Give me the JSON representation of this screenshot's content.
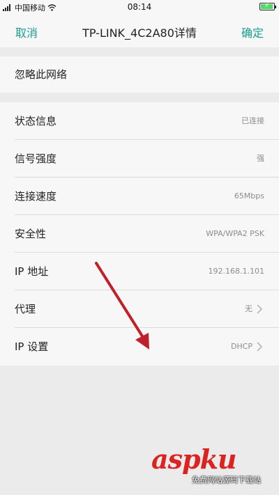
{
  "status_bar": {
    "carrier": "中国移动",
    "time": "08:14"
  },
  "nav": {
    "cancel": "取消",
    "title": "TP-LINK_4C2A80详情",
    "confirm": "确定"
  },
  "forget_network": "忽略此网络",
  "details": [
    {
      "label": "状态信息",
      "value": "已连接"
    },
    {
      "label": "信号强度",
      "value": "强"
    },
    {
      "label": "连接速度",
      "value": "65Mbps"
    },
    {
      "label": "安全性",
      "value": "WPA/WPA2 PSK"
    },
    {
      "label": "IP 地址",
      "value": "192.168.1.101"
    },
    {
      "label": "代理",
      "value": "无"
    },
    {
      "label": "IP 设置",
      "value": "DHCP"
    }
  ],
  "watermark": {
    "brand": "aspku",
    "subtitle": "免费网站源码下载站"
  },
  "colors": {
    "accent": "#1a9c8f",
    "arrow": "#c0202a"
  }
}
